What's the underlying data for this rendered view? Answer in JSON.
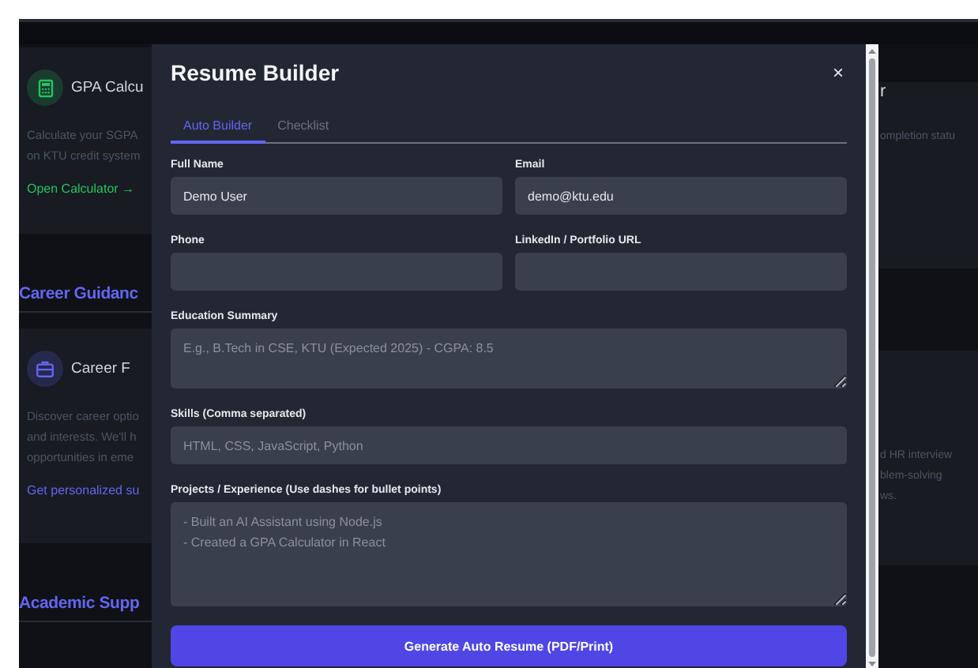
{
  "left_column": [
    {
      "kind": "card",
      "color": "#22c55e",
      "title": "GPA Calcu",
      "lines": [
        "Calculate your SGPA",
        "on KTU credit system"
      ],
      "link": "Open Calculator →"
    },
    {
      "kind": "heading",
      "title": "Career Guidanc"
    },
    {
      "kind": "card",
      "color": "#6366f1",
      "title": "Career F",
      "lines": [
        "Discover career optio",
        "and interests. We'll h",
        "opportunities in eme"
      ],
      "link": "Get personalized su"
    },
    {
      "kind": "heading",
      "title": "Academic Supp"
    }
  ],
  "right_column": [
    {
      "title": "r",
      "lines": [
        "ompletion statu"
      ]
    },
    {
      "lines": [
        "d HR interview",
        "blem-solving",
        "ws."
      ]
    }
  ],
  "modal": {
    "title": "Resume Builder",
    "close": "×",
    "tabs": [
      {
        "label": "Auto Builder",
        "selected": true
      },
      {
        "label": "Checklist",
        "selected": false
      }
    ],
    "fields": [
      {
        "kind": "input",
        "label": "Full Name",
        "value": "Demo User",
        "wide": false
      },
      {
        "kind": "input",
        "label": "Email",
        "value": "demo@ktu.edu",
        "wide": false
      },
      {
        "kind": "input",
        "label": "Phone",
        "wide": false
      },
      {
        "kind": "input",
        "label": "LinkedIn / Portfolio URL",
        "wide": false
      },
      {
        "kind": "textarea",
        "label": "Education Summary",
        "placeholder": "E.g., B.Tech in CSE, KTU (Expected 2025) - CGPA: 8.5",
        "wide": true,
        "tall": false
      },
      {
        "kind": "input",
        "label": "Skills (Comma separated)",
        "placeholder": "HTML, CSS, JavaScript, Python",
        "wide": true
      },
      {
        "kind": "textarea",
        "label": "Projects / Experience (Use dashes for bullet points)",
        "placeholder": "- Built an AI Assistant using Node.js\n- Created a GPA Calculator in React",
        "wide": true,
        "tall": true
      }
    ],
    "button": "Generate Auto Resume (PDF/Print)"
  }
}
